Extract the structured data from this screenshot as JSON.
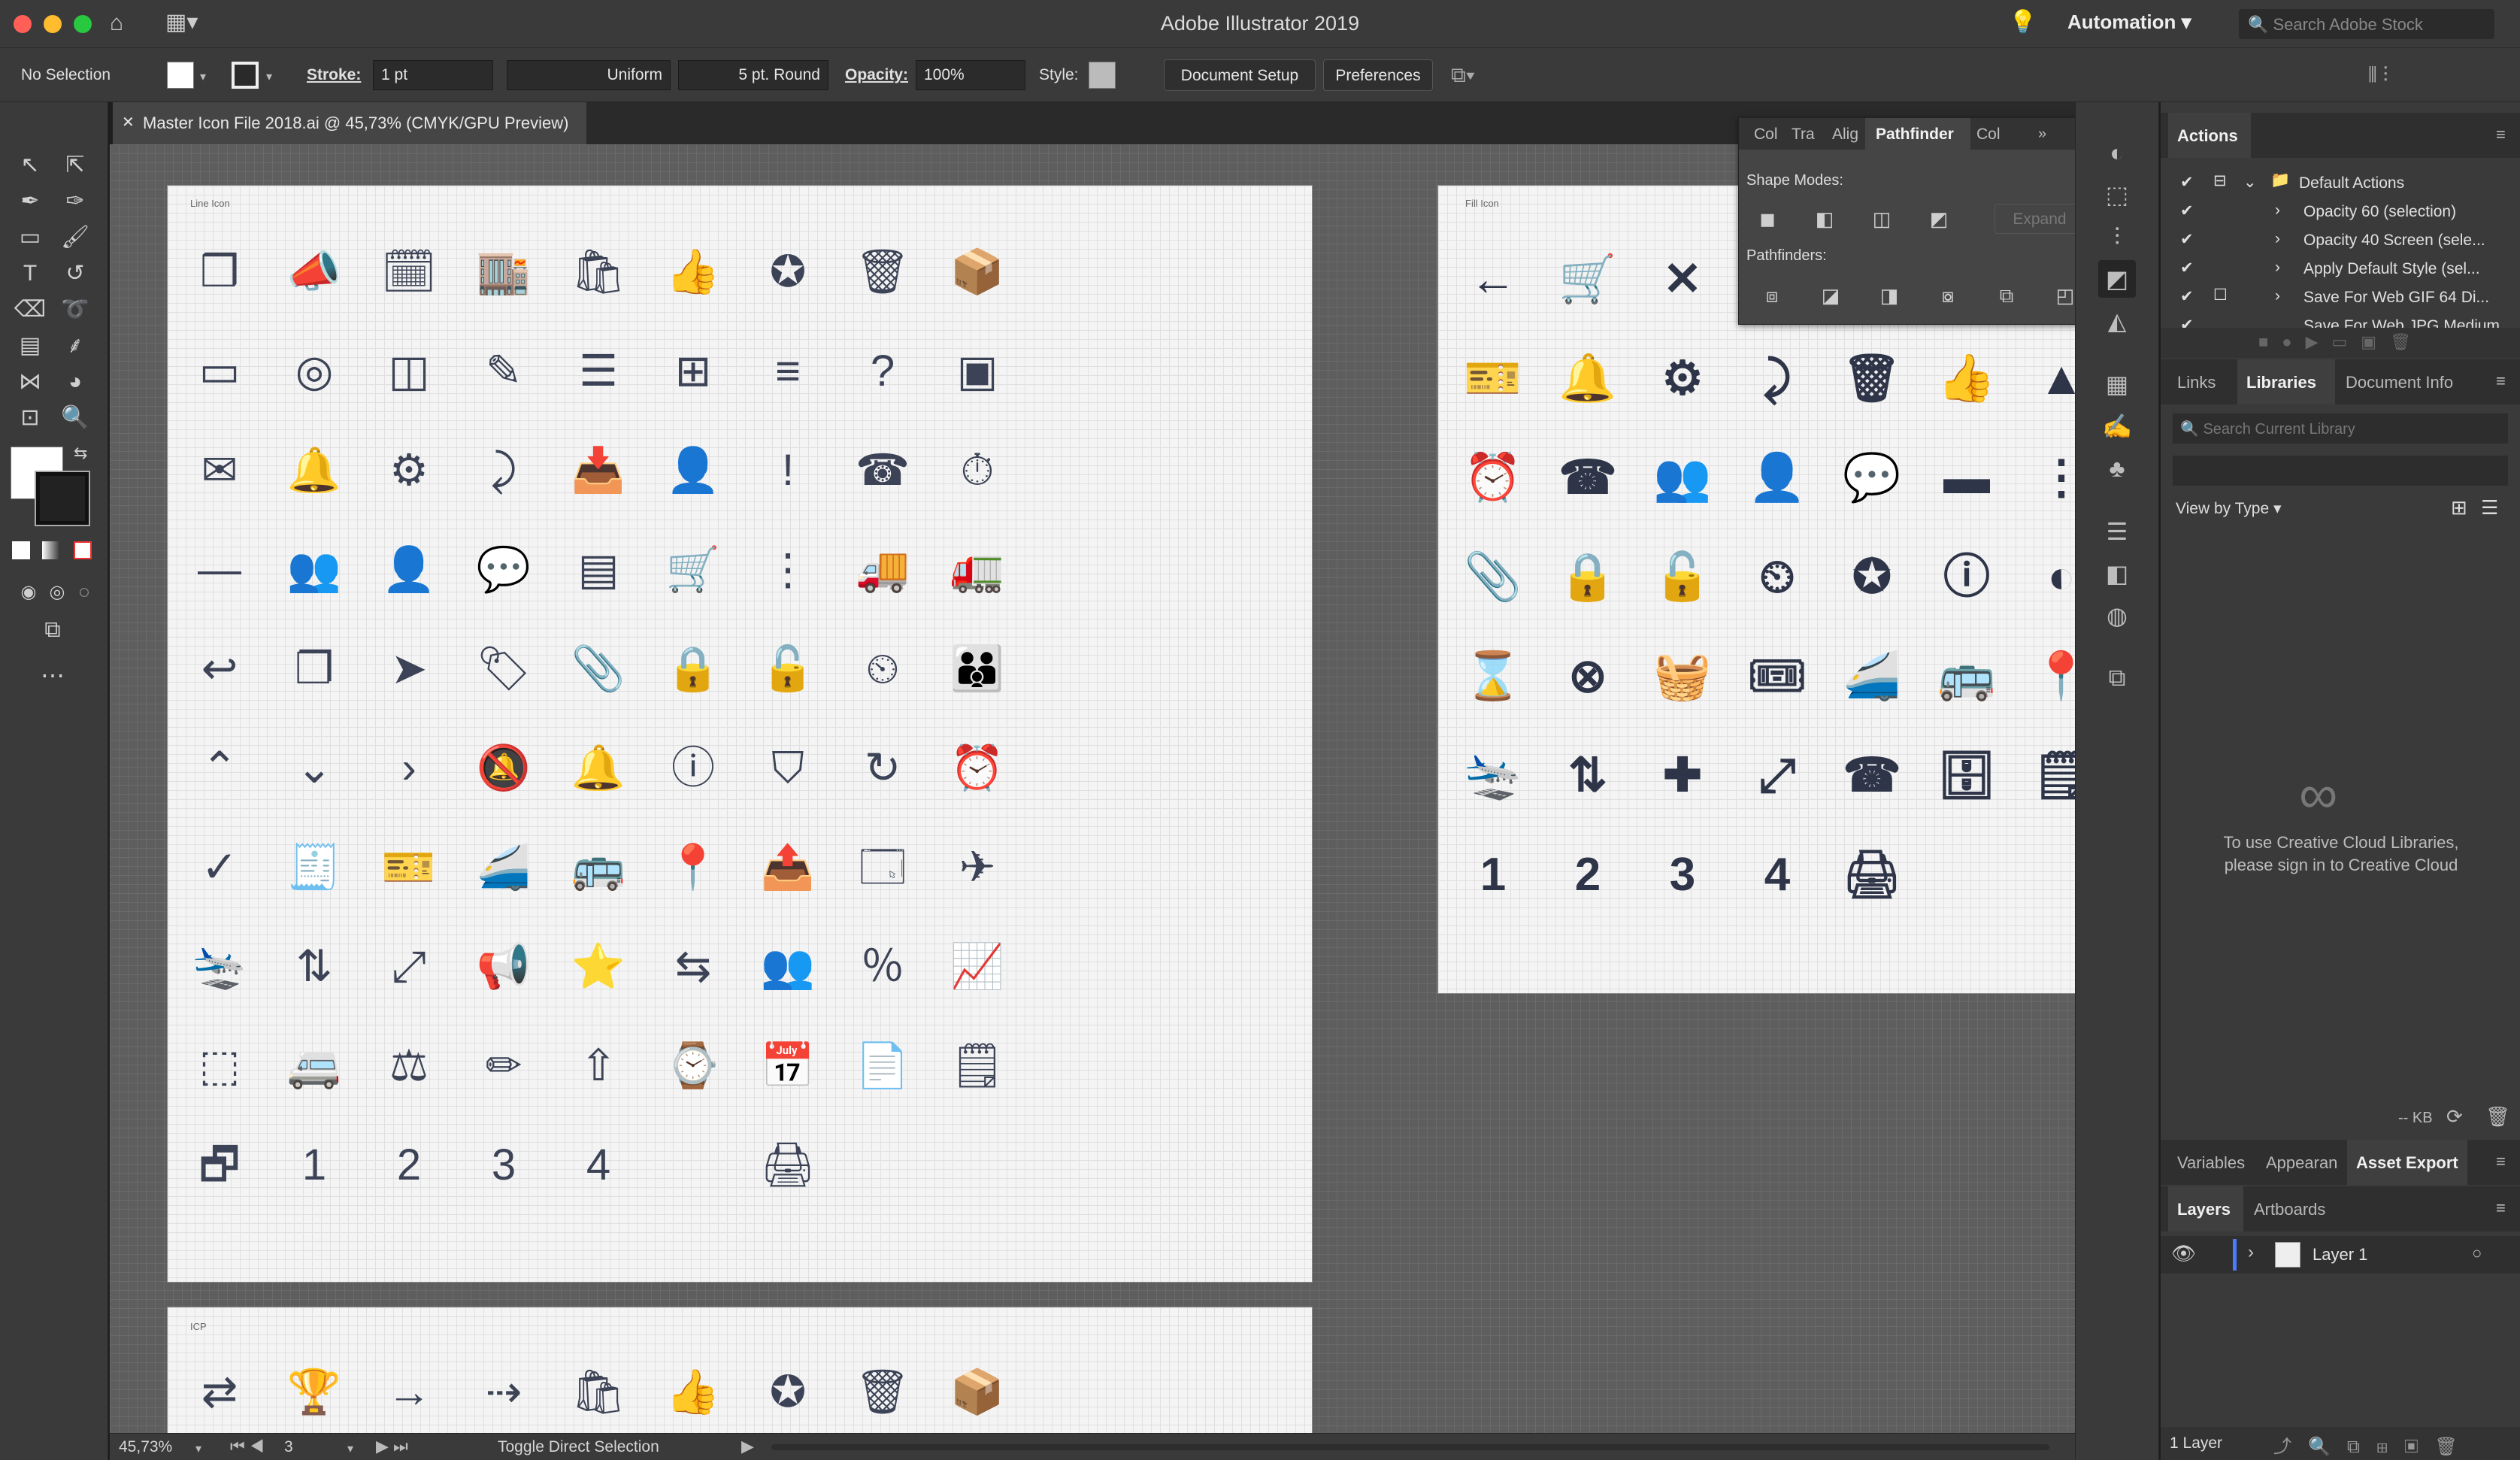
{
  "app": {
    "title": "Adobe Illustrator 2019",
    "workspace": "Automation",
    "search_placeholder": "Search Adobe Stock"
  },
  "control_bar": {
    "selection": "No Selection",
    "stroke_label": "Stroke:",
    "stroke_value": "1 pt",
    "stroke_profile": "Uniform",
    "brush": "5 pt. Round",
    "opacity_label": "Opacity:",
    "opacity_value": "100%",
    "style_label": "Style:",
    "document_setup": "Document Setup",
    "preferences": "Preferences"
  },
  "document": {
    "tab_title": "Master Icon File 2018.ai @ 45,73% (CMYK/GPU Preview)"
  },
  "artboards": {
    "line_label": "Line Icon",
    "fill_label": "Fill Icon",
    "third_label": "ICP"
  },
  "line_icons": [
    [
      "❒",
      "📣",
      "🗓",
      "🏬",
      "🛍",
      "👍",
      "✪",
      "🗑",
      "📦"
    ],
    [
      "▭",
      "◎",
      "◫",
      "✎",
      "☰",
      "⊞",
      "≡",
      "?",
      "▣"
    ],
    [
      "✉",
      "🔔",
      "⚙",
      "⤸",
      "📥",
      "👤",
      "!",
      "☎",
      "⏱"
    ],
    [
      "—",
      "👥",
      "👤",
      "💬",
      "▤",
      "🛒",
      "⋮",
      "🚚",
      "🚛"
    ],
    [
      "↩",
      "❐",
      "➤",
      "🏷",
      "📎",
      "🔒",
      "🔓",
      "⏲",
      "👪"
    ],
    [
      "⌃",
      "⌄",
      "›",
      "🔕",
      "🔔",
      "ⓘ",
      "⛉",
      "↻",
      "⏰"
    ],
    [
      "✓",
      "🧾",
      "🎫",
      "🚄",
      "🚌",
      "📍",
      "📤",
      "🗔",
      "✈"
    ],
    [
      "🛬",
      "⇅",
      "⤢",
      "📢",
      "⭐",
      "⇆",
      "👥",
      "％",
      "📈"
    ],
    [
      "⬚",
      "🚐",
      "⚖",
      "✏",
      "⇧",
      "⌚",
      "📅",
      "📄",
      "🗒"
    ],
    [
      "🗗",
      "1",
      "2",
      "3",
      "4",
      "",
      "🖨",
      "",
      ""
    ]
  ],
  "fill_icons": [
    [
      "←",
      "🛒",
      "✕"
    ],
    [
      "🎫",
      "🔔",
      "⚙",
      "⤸",
      "🗑",
      "👍",
      "▲"
    ],
    [
      "⏰",
      "☎",
      "👥",
      "👤",
      "💬",
      "▬",
      "⋮"
    ],
    [
      "📎",
      "🔒",
      "🔓",
      "⏲",
      "✪",
      "ⓘ",
      "◐"
    ],
    [
      "⌛",
      "⊗",
      "🧺",
      "🎟",
      "🚄",
      "🚌",
      "📍"
    ],
    [
      "🛬",
      "⇅",
      "✚",
      "⤢",
      "☎",
      "🗄",
      "🗒"
    ],
    [
      "1",
      "2",
      "3",
      "4",
      "🖨"
    ]
  ],
  "third_icons": [
    "⇄",
    "🏆",
    "→",
    "⇢",
    "🛍",
    "👍",
    "✪",
    "🗑",
    "📦"
  ],
  "pathfinder": {
    "tabs": [
      "Col",
      "Tra",
      "Alig",
      "Pathfinder",
      "Col"
    ],
    "shape_modes": "Shape Modes:",
    "pathfinders": "Pathfinders:",
    "expand": "Expand"
  },
  "actions": {
    "title": "Actions",
    "set": "Default Actions",
    "items": [
      "Opacity 60 (selection)",
      "Opacity 40 Screen (sele...",
      "Apply Default Style (sel...",
      "Save For Web GIF 64 Di...",
      "Save For Web JPG Medium"
    ]
  },
  "libraries": {
    "tabs": [
      "Links",
      "Libraries",
      "Document Info"
    ],
    "search_placeholder": "Search Current Library",
    "view_by": "View by Type",
    "message": "To use Creative Cloud Libraries, please sign in to Creative Cloud",
    "size": "-- KB"
  },
  "export_tabs": [
    "Variables",
    "Appearan",
    "Asset Export"
  ],
  "layers": {
    "tabs": [
      "Layers",
      "Artboards"
    ],
    "layer_name": "Layer 1",
    "count": "1 Layer"
  },
  "status": {
    "zoom": "45,73%",
    "artboard": "3",
    "tool": "Toggle Direct Selection"
  }
}
